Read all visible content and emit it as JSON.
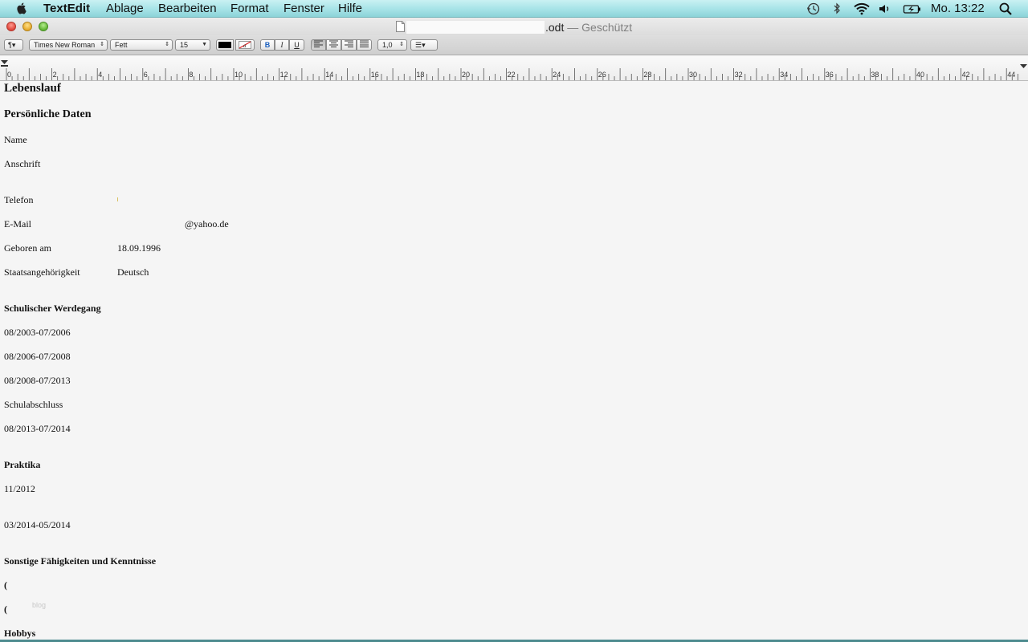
{
  "menubar": {
    "app_name": "TextEdit",
    "items": [
      "Ablage",
      "Bearbeiten",
      "Format",
      "Fenster",
      "Hilfe"
    ],
    "clock": "Mo. 13:22"
  },
  "window": {
    "title_suffix": ".odt",
    "title_separator": "—",
    "title_status": "Geschützt"
  },
  "toolbar": {
    "paragraph_label": "¶▾",
    "font_family": "Times New Roman",
    "font_style": "Fett",
    "font_size": "15",
    "bold": "B",
    "italic": "I",
    "underline": "U",
    "line_spacing": "1,0",
    "list_label": "☰▾"
  },
  "ruler": {
    "labels": [
      "0",
      "2",
      "4",
      "6",
      "8",
      "10",
      "12",
      "14",
      "16",
      "18",
      "20",
      "22",
      "24",
      "26",
      "28",
      "30",
      "32",
      "34",
      "36",
      "38",
      "40",
      "42",
      "44"
    ]
  },
  "document": {
    "title": "Lebenslauf",
    "personal_heading": "Persönliche Daten",
    "name_label": "Name",
    "address_label": "Anschrift",
    "phone_label": "Telefon",
    "email_label": "E-Mail",
    "email_value": "@yahoo.de",
    "born_label": "Geboren am",
    "born_value": "18.09.1996",
    "nationality_label": "Staatsangehörigkeit",
    "nationality_value": "Deutsch",
    "school_heading": "Schulischer Werdegang",
    "school_1": "08/2003-07/2006",
    "school_2": "08/2006-07/2008",
    "school_3": "08/2008-07/2013",
    "school_degree_label": "Schulabschluss",
    "school_4": "08/2013-07/2014",
    "internship_heading": "Praktika",
    "internship_1": "11/2012",
    "internship_2": "03/2014-05/2014",
    "skills_heading": "Sonstige Fähigkeiten und Kenntnisse",
    "skills_bullet": "(",
    "watermark": "blog",
    "hobbies_heading": "Hobbys"
  },
  "colors": {
    "menubar": "#a6e3e7",
    "window_chrome": "#dcdcdc",
    "document_bg": "#f5f5f5"
  }
}
